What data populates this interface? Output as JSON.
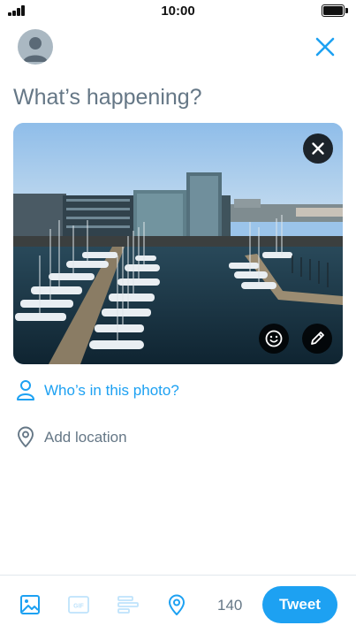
{
  "status_bar": {
    "time": "10:00"
  },
  "compose": {
    "placeholder": "What’s happening?"
  },
  "media": {
    "tag_people_label": "Who’s in this photo?"
  },
  "location": {
    "label": "Add location"
  },
  "toolbar": {
    "char_count": "140",
    "tweet_label": "Tweet"
  },
  "icons": {
    "close": "close-icon",
    "remove_photo": "close-icon",
    "sticker": "smiley-icon",
    "edit": "pencil-icon",
    "tag_people": "person-icon",
    "location": "location-pin-icon",
    "photo": "image-icon",
    "gif": "gif-icon",
    "poll": "poll-icon"
  },
  "colors": {
    "accent": "#1da1f2",
    "secondary_text": "#657786",
    "divider": "#e1e8ed"
  }
}
